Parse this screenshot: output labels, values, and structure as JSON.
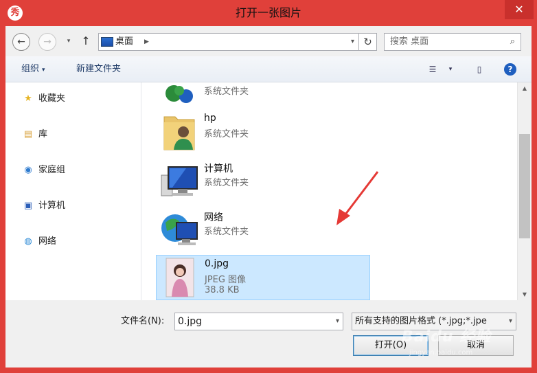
{
  "window": {
    "title": "打开一张图片",
    "app_icon_glyph": "秀",
    "close_glyph": "✕"
  },
  "nav": {
    "back_glyph": "←",
    "forward_glyph": "→",
    "recent_glyph": "▾",
    "up_glyph": "↑",
    "address_text": "桌面",
    "address_sep": "▶",
    "address_dd": "▾",
    "refresh_glyph": "↻",
    "search_placeholder": "搜索 桌面",
    "search_glyph": "⌕"
  },
  "toolbar": {
    "organize_label": "组织",
    "organize_caret": "▾",
    "new_folder_label": "新建文件夹",
    "view_glyph": "☰",
    "view_caret": "▾",
    "preview_glyph": "▯",
    "help_glyph": "?"
  },
  "sidebar": {
    "items": [
      {
        "label": "收藏夹",
        "icon": "star-icon",
        "glyph": "★",
        "color": "#e6b422"
      },
      {
        "label": "库",
        "icon": "library-icon",
        "glyph": "▤",
        "color": "#d9a441"
      },
      {
        "label": "家庭组",
        "icon": "homegroup-icon",
        "glyph": "◉",
        "color": "#2e7bcf"
      },
      {
        "label": "计算机",
        "icon": "computer-icon",
        "glyph": "▣",
        "color": "#2d5fb8"
      },
      {
        "label": "网络",
        "icon": "network-icon",
        "glyph": "◍",
        "color": "#2c8ad6"
      }
    ]
  },
  "files": [
    {
      "name": "",
      "type": "系统文件夹",
      "size": "",
      "icon": "network-folder-icon"
    },
    {
      "name": "hp",
      "type": "系统文件夹",
      "size": "",
      "icon": "user-folder-icon"
    },
    {
      "name": "计算机",
      "type": "系统文件夹",
      "size": "",
      "icon": "computer-icon"
    },
    {
      "name": "网络",
      "type": "系统文件夹",
      "size": "",
      "icon": "network-icon"
    },
    {
      "name": "0.jpg",
      "type": "JPEG 图像",
      "size": "38.8 KB",
      "icon": "image-thumbnail-icon",
      "selected": true
    }
  ],
  "bottom": {
    "filename_label": "文件名(N):",
    "filename_value": "0.jpg",
    "filename_dd": "▾",
    "filter_value": "所有支持的图片格式 (*.jpg;*.jpe",
    "filter_dd": "▾",
    "open_label": "打开(O)",
    "cancel_label": "取消"
  },
  "scroll": {
    "up_glyph": "▲",
    "down_glyph": "▼"
  },
  "watermark": {
    "main": "Baidu 经验",
    "sub": "jingyan.baidu.com"
  },
  "colors": {
    "titlebar": "#e0403a",
    "selection": "#cce8ff",
    "arrow": "#e53935"
  }
}
